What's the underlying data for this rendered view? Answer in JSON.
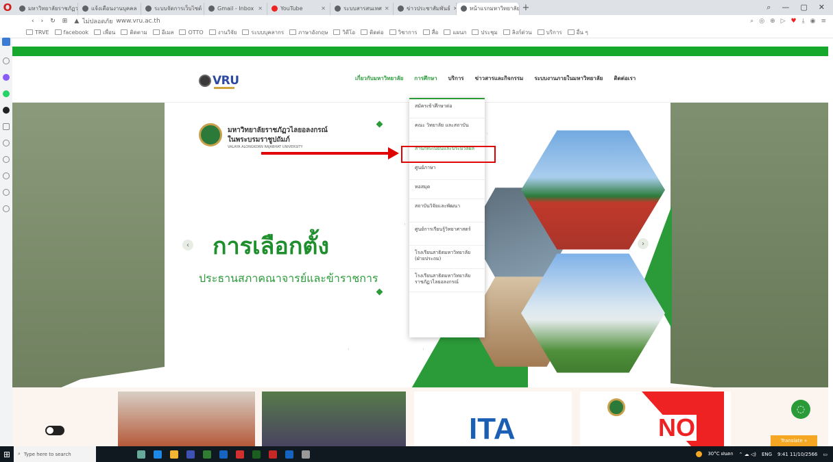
{
  "browser": {
    "tabs": [
      {
        "label": "มหาวิทยาลัยราชภัฏวไลยฯ"
      },
      {
        "label": "แจ้งเตือนงานบุคคล"
      },
      {
        "label": "ระบบจัดการเว็บไซต์"
      },
      {
        "label": "Gmail - Inbox"
      },
      {
        "label": "YouTube"
      },
      {
        "label": "ระบบสารสนเทศ"
      },
      {
        "label": "ข่าวประชาสัมพันธ์"
      },
      {
        "label": "หน้าแรกมหาวิทยาลัย - ยกเว้น"
      }
    ],
    "new_tab": "+",
    "url_security": "ไม่ปลอดภัย",
    "url": "www.vru.ac.th",
    "bookmarks": [
      "TRVE",
      "facebook",
      "เพื่อน",
      "ติดตาม",
      "อีเมล",
      "OTTO",
      "งานวิจัย",
      "ระบบบุคลากร",
      "ภาษาอังกฤษ",
      "วิดีโอ",
      "ติดต่อ",
      "วิชาการ",
      "สื่อ",
      "แผนก",
      "ประชุม",
      "ลิงก์ด่วน",
      "บริการ",
      "อื่น ๆ"
    ]
  },
  "site": {
    "logo_text": "VRU",
    "menu": [
      {
        "label": "เกี่ยวกับมหาวิทยาลัย",
        "highlight": true
      },
      {
        "label": "การศึกษา",
        "highlight": true
      },
      {
        "label": "บริการ"
      },
      {
        "label": "ข่าวสารและกิจกรรม"
      },
      {
        "label": "ระบบงานภายในมหาวิทยาลัย"
      },
      {
        "label": "ติดต่อเรา"
      }
    ],
    "dropdown": [
      "สมัครเข้าศึกษาต่อ",
      "คณะ วิทยาลัย และสถาบัน",
      "สำนักทะเบียนและประมวลผล",
      "ศูนย์ภาษา",
      "หอสมุด",
      "สถาบันวิจัยและพัฒนา",
      "ศูนย์การเรียนรู้วิทยาศาสตร์",
      "โรงเรียนสาธิตมหาวิทยาลัย (ฝ่ายประถม)",
      "โรงเรียนสาธิตมหาวิทยาลัย ราชภัฏวไลยอลงกรณ์"
    ],
    "hero": {
      "uni_name_line1": "มหาวิทยาลัยราชภัฏวไลยอลงกรณ์",
      "uni_name_line2": "ในพระบรมราชูปถัมภ์",
      "uni_sub": "VALAYA ALONGKORN RAJABHAT UNIVERSITY",
      "title": "การเลือกตั้ง",
      "subtitle": "ประธานสภาคณาจารย์และข้าราชการ",
      "prev": "‹",
      "next": "›"
    },
    "cards": {
      "ita": "ITA",
      "no": "NO"
    },
    "translate": "Translate »",
    "chat_icon": "chat-icon"
  },
  "taskbar": {
    "search_placeholder": "Type here to search",
    "weather": "30°C ฝนตก",
    "time": "9:41",
    "date": "11/10/2566",
    "lang": "ENG"
  },
  "colors": {
    "brand_green": "#15a82c",
    "accent_red": "#e00000",
    "hero_green": "#1f8f2e"
  }
}
